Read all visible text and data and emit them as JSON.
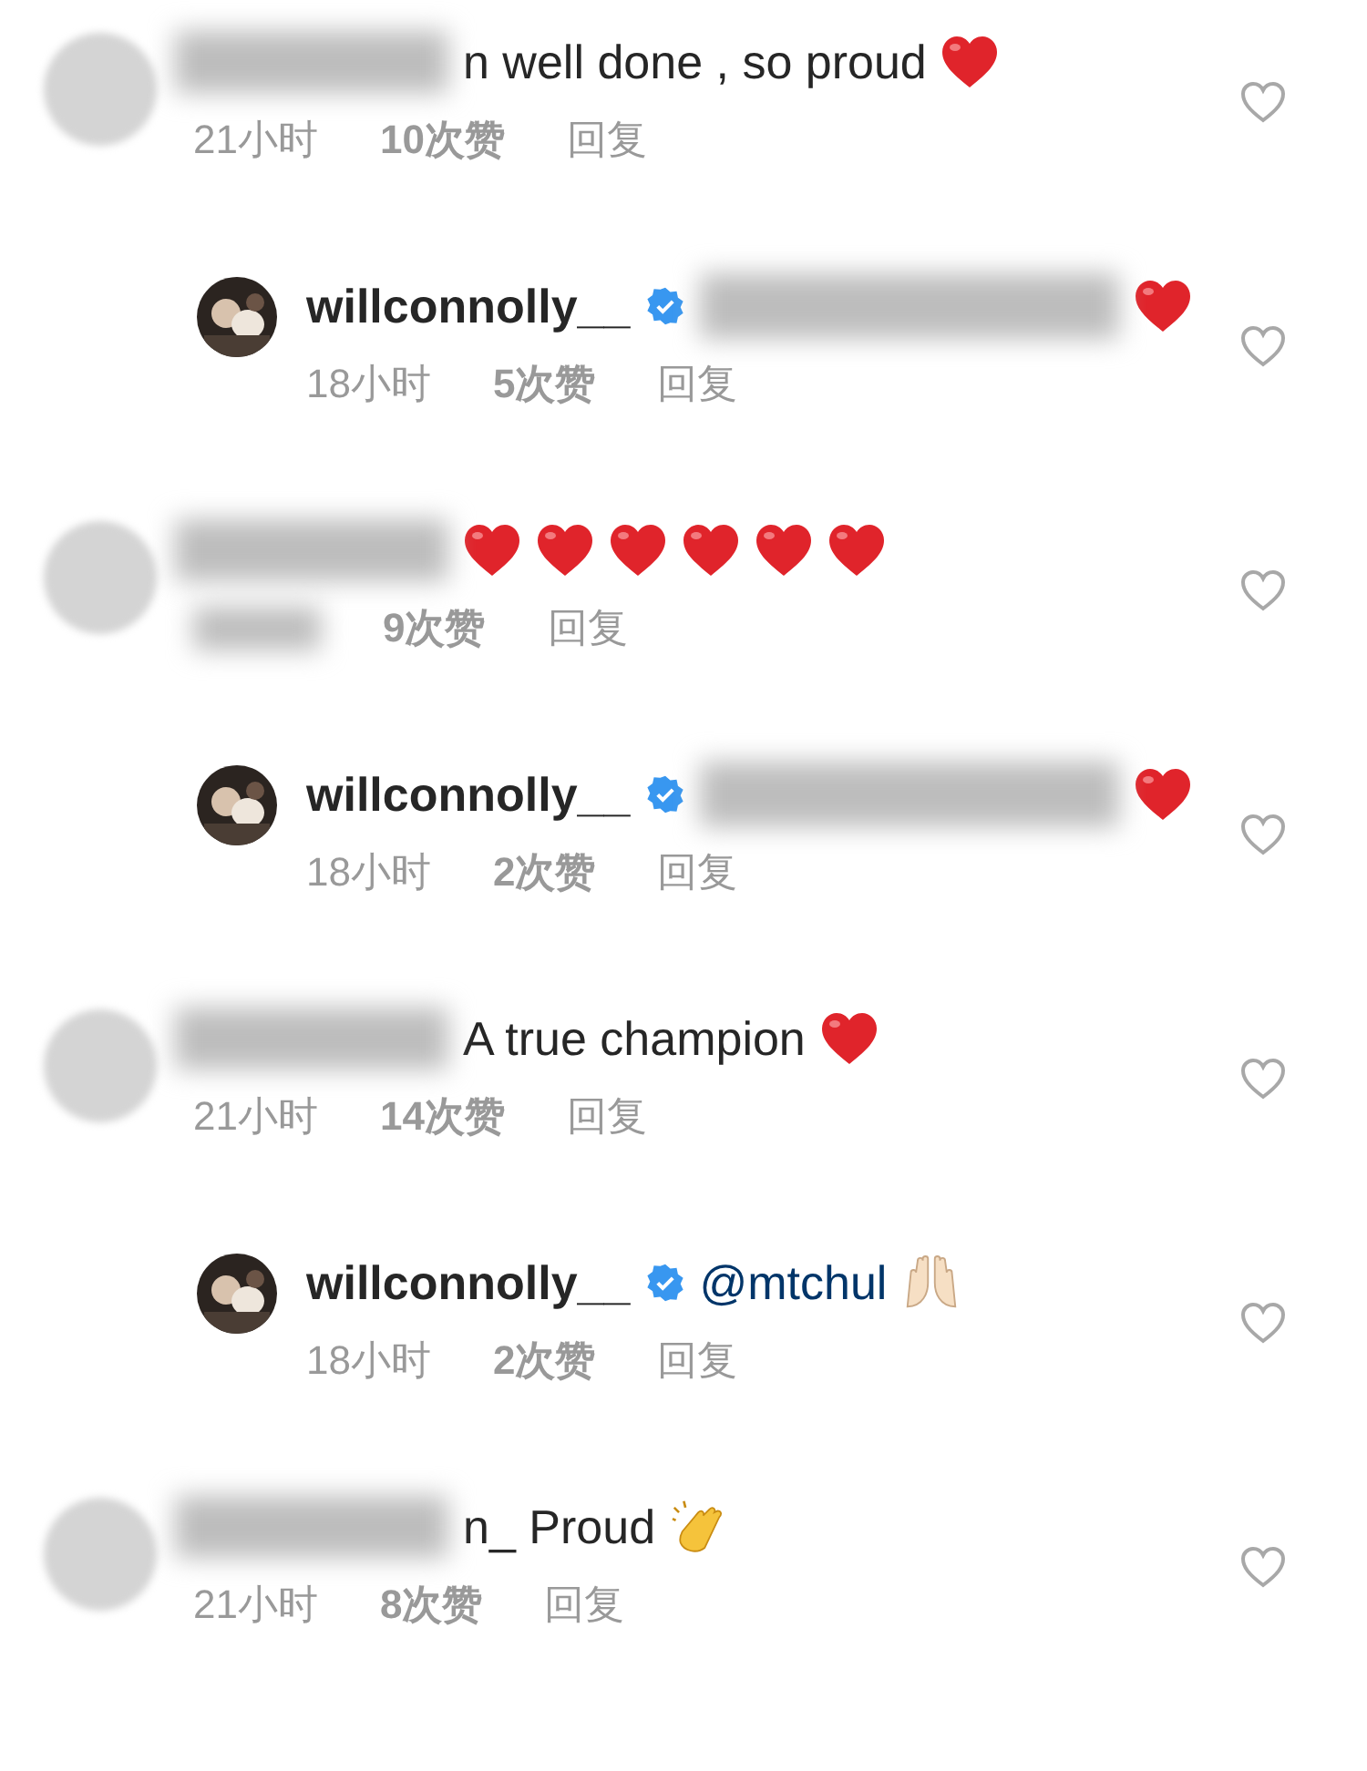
{
  "comments": [
    {
      "kind": "comment",
      "name_blurred": true,
      "text": "n well done , so proud",
      "emoji": [
        {
          "kind": "heart"
        }
      ],
      "time": "21小时",
      "likes": "10次赞",
      "reply": "回复"
    },
    {
      "kind": "reply",
      "username": "willconnolly__",
      "verified": true,
      "mention_blurred": true,
      "emoji": [
        {
          "kind": "heart"
        }
      ],
      "time": "18小时",
      "likes": "5次赞",
      "reply": "回复"
    },
    {
      "kind": "comment",
      "name_blurred": true,
      "emoji": [
        {
          "kind": "heart"
        },
        {
          "kind": "heart"
        },
        {
          "kind": "heart"
        },
        {
          "kind": "heart"
        },
        {
          "kind": "heart"
        },
        {
          "kind": "heart"
        }
      ],
      "likes": "9次赞",
      "reply": "回复"
    },
    {
      "kind": "reply",
      "username": "willconnolly__",
      "verified": true,
      "mention_blurred": true,
      "emoji": [
        {
          "kind": "heart"
        }
      ],
      "time": "18小时",
      "likes": "2次赞",
      "reply": "回复"
    },
    {
      "kind": "comment",
      "name_blurred": true,
      "text": "A true champion",
      "emoji": [
        {
          "kind": "heart"
        }
      ],
      "time": "21小时",
      "likes": "14次赞",
      "reply": "回复"
    },
    {
      "kind": "reply",
      "username": "willconnolly__",
      "verified": true,
      "mention_blurred": false,
      "mention": "@mtchul",
      "emoji": [
        {
          "kind": "raised-hands"
        }
      ],
      "time": "18小时",
      "likes": "2次赞",
      "reply": "回复"
    },
    {
      "kind": "comment",
      "name_blurred": true,
      "text": "n_ Proud",
      "emoji": [
        {
          "kind": "clap"
        }
      ],
      "time": "21小时",
      "likes": "8次赞",
      "reply": "回复"
    }
  ]
}
